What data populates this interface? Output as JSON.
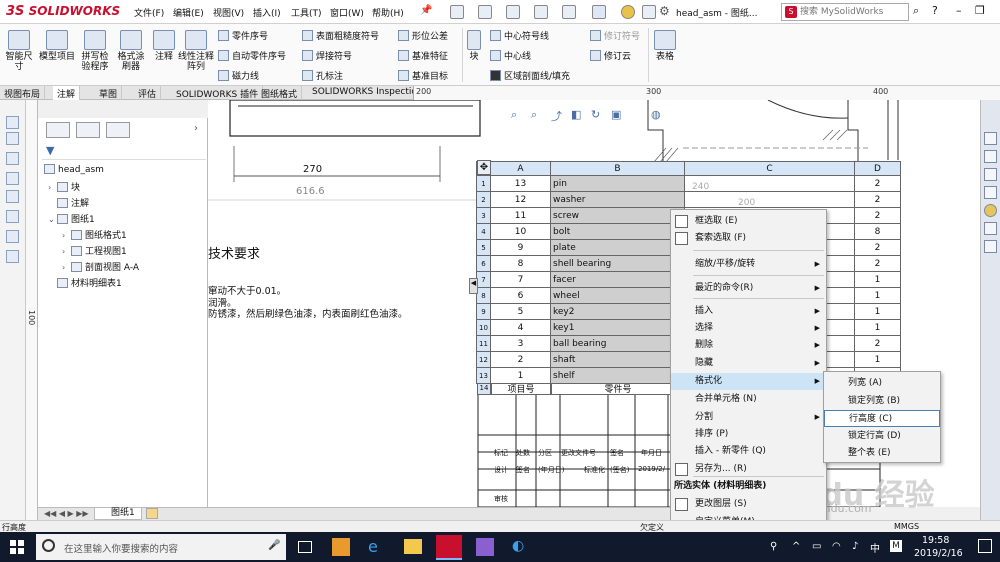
{
  "app": {
    "brand_prefix": "3S",
    "brand": "SOLIDWORKS",
    "doc_title": "head_asm - 图纸...",
    "search_placeholder": "搜索 MySolidWorks"
  },
  "menus": [
    "文件(F)",
    "编辑(E)",
    "视图(V)",
    "插入(I)",
    "工具(T)",
    "窗口(W)",
    "帮助(H)"
  ],
  "ribbon": {
    "big": [
      "智能尺寸",
      "模型项目",
      "拼写检验程序",
      "格式涂刷器",
      "注释",
      "线性注释阵列"
    ],
    "small": [
      [
        "零件序号",
        "自动零件序号",
        "磁力线"
      ],
      [
        "表面粗糙度符号",
        "焊接符号",
        "孔标注"
      ],
      [
        "形位公差",
        "基准特征",
        "基准目标"
      ],
      [
        "中心符号线",
        "中心线",
        "区域剖面线/填充"
      ],
      [
        "修订符号",
        "修订云"
      ]
    ],
    "block": "块",
    "table": "表格"
  },
  "tabs": [
    "视图布局",
    "注解",
    "草图",
    "评估",
    "SOLIDWORKS 插件",
    "图纸格式",
    "SOLIDWORKS Inspection"
  ],
  "ruler": [
    "200",
    "300",
    "400"
  ],
  "vruler": "100",
  "tree": {
    "root": "head_asm",
    "items": [
      "块",
      "注解",
      "图纸1",
      "图纸格式1",
      "工程视图1",
      "剖面视图 A-A",
      "材料明细表1"
    ]
  },
  "drawing": {
    "dim1": "270",
    "dim2": "616.6",
    "tech_title": "技术要求",
    "tech_lines": [
      "窜动不大于0.01。",
      "润滑。",
      "防锈漆，然后刷绿色油漆，内表面刷红色油漆。"
    ],
    "dim3": "240",
    "dim4": "200"
  },
  "bom": {
    "columns": [
      "A",
      "B",
      "C",
      "D"
    ],
    "rows": [
      {
        "n": "1",
        "a": "13",
        "b": "pin",
        "d": "2"
      },
      {
        "n": "2",
        "a": "12",
        "b": "washer",
        "d": "2"
      },
      {
        "n": "3",
        "a": "11",
        "b": "screw",
        "d": "2"
      },
      {
        "n": "4",
        "a": "10",
        "b": "bolt",
        "d": "8"
      },
      {
        "n": "5",
        "a": "9",
        "b": "plate",
        "d": "2"
      },
      {
        "n": "6",
        "a": "8",
        "b": "shell bearing",
        "d": "2"
      },
      {
        "n": "7",
        "a": "7",
        "b": "facer",
        "d": "1"
      },
      {
        "n": "8",
        "a": "6",
        "b": "wheel",
        "d": "1"
      },
      {
        "n": "9",
        "a": "5",
        "b": "key2",
        "d": "1"
      },
      {
        "n": "10",
        "a": "4",
        "b": "key1",
        "d": "1"
      },
      {
        "n": "11",
        "a": "3",
        "b": "ball bearing",
        "d": "2"
      },
      {
        "n": "12",
        "a": "2",
        "b": "shaft",
        "d": "1"
      },
      {
        "n": "13",
        "a": "1",
        "b": "shelf",
        "d": "1"
      }
    ],
    "footer_row": "14",
    "header_a": "项目号",
    "header_b": "零件号"
  },
  "title_block": {
    "row1": [
      "标记",
      "处数",
      "分区",
      "更改文件号",
      "签名",
      "年月日"
    ],
    "row2": [
      "设计",
      "签名",
      "(年月日)",
      "标准化",
      "(签名)",
      "2019/2/"
    ],
    "row3": [
      "审核"
    ]
  },
  "context_menu": {
    "items": [
      "框选取 (E)",
      "套索选取 (F)",
      "缩放/平移/旋转",
      "最近的命令(R)",
      "插入",
      "选择",
      "删除",
      "隐藏",
      "格式化",
      "合并单元格 (N)",
      "分割",
      "排序 (P)",
      "插入 - 新零件 (Q)",
      "另存为... (R)",
      "所选实体 (材料明细表)",
      "更改图层 (S)",
      "自定义菜单(M)"
    ]
  },
  "submenu": {
    "items": [
      "列宽 (A)",
      "锁定列宽 (B)",
      "行高度 (C)",
      "锁定行高 (D)",
      "整个表 (E)"
    ]
  },
  "status": {
    "left": "行高度",
    "right1": "欠定义",
    "right2": "MMGS"
  },
  "taskbar": {
    "search": "在这里输入你要搜索的内容",
    "time": "19:58",
    "date": "2019/2/16",
    "ime": "中"
  },
  "watermark": "Baidu 经验",
  "watermark_url": "jingyan.baidu.com"
}
